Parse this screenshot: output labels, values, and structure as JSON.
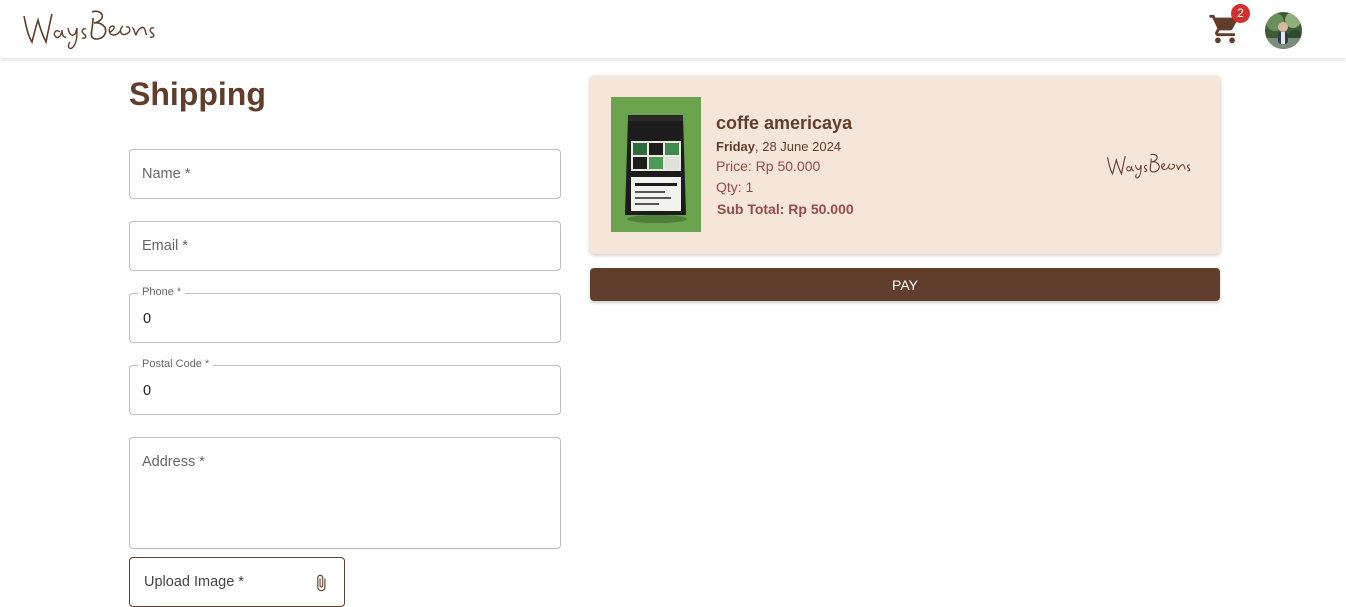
{
  "header": {
    "logo_text": "WaysBeans",
    "cart_count": "2"
  },
  "shipping": {
    "title": "Shipping",
    "name_label": "Name *",
    "email_label": "Email *",
    "phone_label": "Phone *",
    "phone_value": "0",
    "postal_label": "Postal Code *",
    "postal_value": "0",
    "address_label": "Address *",
    "upload_label": "Upload Image *"
  },
  "order": {
    "product_name": "coffe americaya",
    "date_day": "Friday",
    "date_rest": ", 28 June 2024",
    "price": "Price: Rp 50.000",
    "qty": "Qty: 1",
    "subtotal": "Sub Total: Rp 50.000",
    "brand_logo_text": "WaysBeans",
    "pay_label": "PAY"
  },
  "colors": {
    "brand": "#613D2B",
    "card_bg": "#F6E6DA",
    "accent_text": "#974A4A",
    "badge": "#d32f2f"
  },
  "icons": {
    "cart": "shopping-cart-icon",
    "upload": "paperclip-icon"
  }
}
